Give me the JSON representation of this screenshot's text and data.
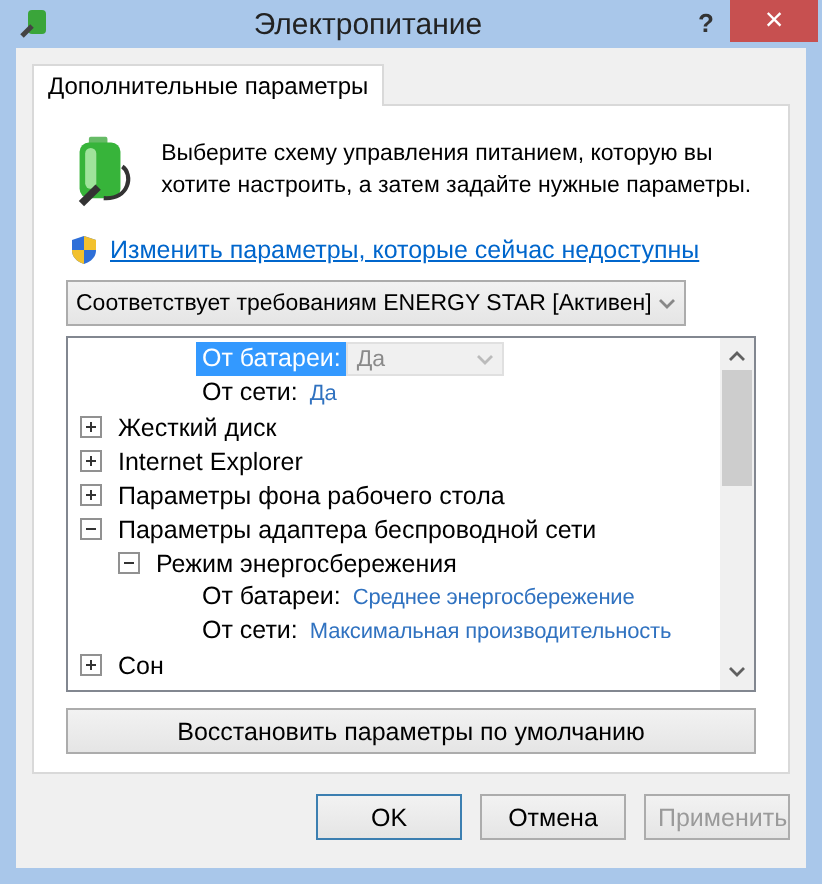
{
  "window": {
    "title": "Электропитание",
    "help": "?",
    "close": "×"
  },
  "tabs": [
    {
      "label": "Дополнительные параметры",
      "selected": true
    }
  ],
  "intro": "Выберите схему управления питанием, которую вы хотите настроить, а затем задайте нужные параметры.",
  "link": "Изменить параметры, которые сейчас недоступны",
  "plan_select": {
    "value": "Соответствует требованиям ENERGY STAR [Активен]"
  },
  "tree": [
    {
      "children": [
        {
          "children": [
            {
              "kind": "select",
              "label": "От батареи:",
              "value": "Да",
              "selected": true,
              "disabled": true
            },
            {
              "kind": "setting",
              "label": "От сети:",
              "value": "Да",
              "selected": false
            }
          ]
        }
      ]
    },
    {
      "label": "Жесткий диск",
      "expanded": false
    },
    {
      "label": "Internet Explorer",
      "expanded": false
    },
    {
      "label": "Параметры фона рабочего стола",
      "expanded": false
    },
    {
      "label": "Параметры адаптера беспроводной сети",
      "expanded": true,
      "children": [
        {
          "label": "Режим энергосбережения",
          "expanded": true,
          "children": [
            {
              "kind": "setting",
              "label": "От батареи:",
              "value": "Среднее энергосбережение",
              "selected": false
            },
            {
              "kind": "setting",
              "label": "От сети:",
              "value": "Максимальная производительность",
              "selected": false
            }
          ]
        }
      ]
    },
    {
      "label": "Сон",
      "expanded": false
    }
  ],
  "restore_button": "Восстановить параметры по умолчанию",
  "buttons": [
    {
      "label": "OK",
      "default": true,
      "disabled": false
    },
    {
      "label": "Отмена",
      "default": false,
      "disabled": false
    },
    {
      "label": "Применить",
      "default": false,
      "disabled": true
    }
  ]
}
